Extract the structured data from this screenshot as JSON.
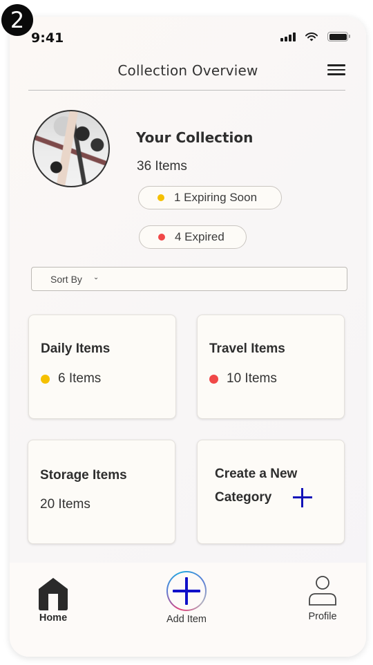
{
  "step_badge": "2",
  "status_bar": {
    "time": "9:41",
    "icons": [
      "signal-icon",
      "wifi-icon",
      "battery-icon"
    ]
  },
  "header": {
    "title": "Collection Overview",
    "menu_icon": "hamburger-menu-icon"
  },
  "collection": {
    "title": "Your Collection",
    "count": "36 Items",
    "badges": [
      {
        "label": "1 Expiring Soon",
        "color": "#f5c000"
      },
      {
        "label": "4 Expired",
        "color": "#f04848"
      }
    ]
  },
  "sort": {
    "label": "Sort By",
    "icon": "chevron-down-icon"
  },
  "categories": [
    {
      "title": "Daily Items",
      "count": "6 Items",
      "dot_color": "#f5c000"
    },
    {
      "title": "Travel Items",
      "count": "10 Items",
      "dot_color": "#f04848"
    },
    {
      "title": "Storage Items",
      "count": "20 Items"
    }
  ],
  "create_category": {
    "line1": "Create a New",
    "line2": "Category",
    "icon": "plus-icon",
    "accent": "#1212b8"
  },
  "bottom_nav": {
    "items": [
      {
        "label": "Home",
        "icon": "home-icon",
        "active": true
      },
      {
        "label": "Add Item",
        "icon": "add-circle-icon"
      },
      {
        "label": "Profile",
        "icon": "profile-icon"
      }
    ]
  }
}
